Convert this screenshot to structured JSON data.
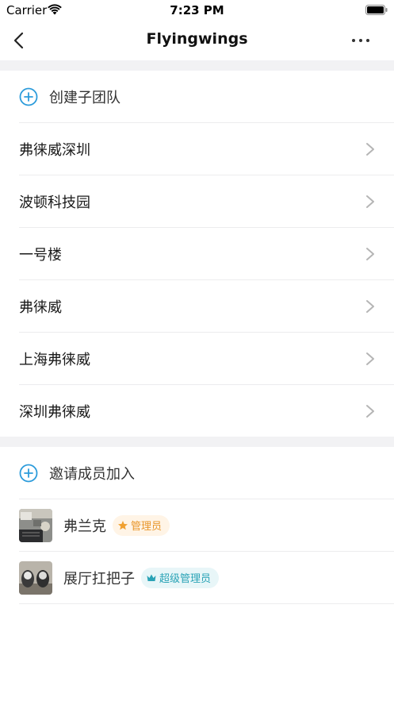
{
  "status_bar": {
    "carrier": "Carrier",
    "time": "7:23 PM"
  },
  "navbar": {
    "title": "Flyingwings"
  },
  "create_subteam": {
    "label": "创建子团队"
  },
  "subteams": [
    {
      "label": "弗徕威深圳"
    },
    {
      "label": "波顿科技园"
    },
    {
      "label": "一号楼"
    },
    {
      "label": "弗徕威"
    },
    {
      "label": "上海弗徕威"
    },
    {
      "label": "深圳弗徕威"
    }
  ],
  "invite": {
    "label": "邀请成员加入"
  },
  "members": [
    {
      "name": "弗兰克",
      "role": "管理员"
    },
    {
      "name": "展厅扛把子",
      "role": "超级管理员"
    }
  ],
  "colors": {
    "accent": "#2d9cdb",
    "admin": "#e8962a",
    "super_admin": "#2aa3b6"
  }
}
